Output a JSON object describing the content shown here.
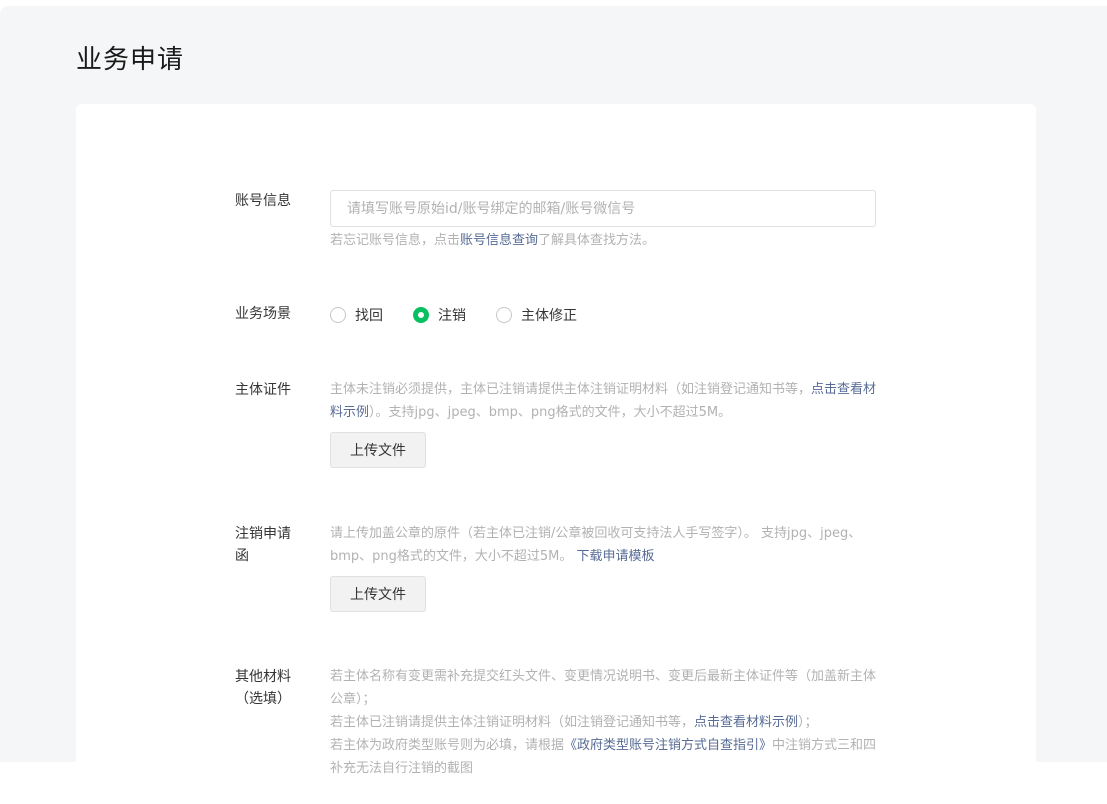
{
  "page": {
    "title": "业务申请"
  },
  "form": {
    "account": {
      "label": "账号信息",
      "placeholder": "请填写账号原始id/账号绑定的邮箱/账号微信号",
      "hint_prefix": "若忘记账号信息，点击",
      "hint_link": "账号信息查询",
      "hint_suffix": "了解具体查找方法。"
    },
    "scenario": {
      "label": "业务场景",
      "options": [
        {
          "label": "找回",
          "checked": false
        },
        {
          "label": "注销",
          "checked": true
        },
        {
          "label": "主体修正",
          "checked": false
        }
      ]
    },
    "entity_cert": {
      "label": "主体证件",
      "hint_prefix": "主体未注销必须提供，主体已注销请提供主体注销证明材料（如注销登记通知书等，",
      "hint_link": "点击查看材料示例",
      "hint_suffix": "）。支持jpg、jpeg、bmp、png格式的文件，大小不超过5M。",
      "upload_label": "上传文件"
    },
    "cancel_letter": {
      "label": "注销申请函",
      "hint_prefix": "请上传加盖公章的原件（若主体已注销/公章被回收可支持法人手写签字）。 支持jpg、jpeg、bmp、png格式的文件，大小不超过5M。 ",
      "hint_link": "下载申请模板",
      "upload_label": "上传文件"
    },
    "other": {
      "label": "其他材料（选填）",
      "line1": "若主体名称有变更需补充提交红头文件、变更情况说明书、变更后最新主体证件等（加盖新主体公章）；",
      "line2_prefix": "若主体已注销请提供主体注销证明材料（如注销登记通知书等，",
      "line2_link": "点击查看材料示例",
      "line2_suffix": "）；",
      "line3_prefix": "若主体为政府类型账号则为必填，请根据",
      "line3_link": "《政府类型账号注销方式自查指引》",
      "line3_suffix": "中注销方式三和四补充无法自行注销的截图"
    }
  },
  "colors": {
    "accent_green": "#07c160",
    "link_blue": "#576b95",
    "hint_gray": "#b2b2b2"
  }
}
